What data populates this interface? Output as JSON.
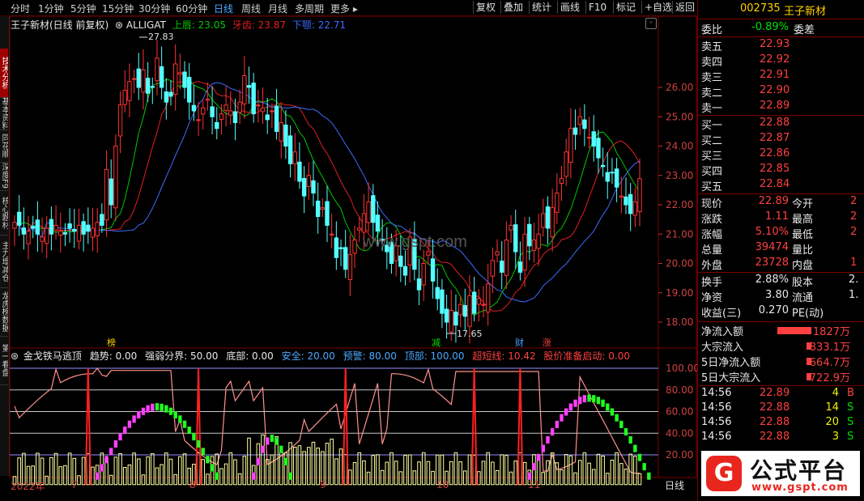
{
  "toolbar": {
    "periods": [
      "分时",
      "1分钟",
      "5分钟",
      "15分钟",
      "30分钟",
      "60分钟",
      "日线",
      "周线",
      "月线",
      "多周期",
      "更多 ▸"
    ],
    "active_period": "日线",
    "buttons": [
      "复权",
      "叠加",
      "统计",
      "画线",
      "F10",
      "标记",
      "+自选",
      "返回"
    ],
    "close_glyph": "⊗"
  },
  "side_tabs": [
    "技术分析",
    "基本资料",
    "同花顺F10",
    "深度F9",
    "核心题材",
    "主力增减仓",
    "龙虎榜数据",
    "第一看盘"
  ],
  "main_chart": {
    "title": "王子新材(日线 前复权)",
    "indicator_name": "ALLIGAT",
    "upper_label": "上唇: 23.05",
    "teeth_label": "牙齿: 23.87",
    "lower_label": "下颚: 22.71",
    "high_label": "27.83",
    "low_label": "17.65",
    "watermark": "www.gspt.com",
    "y_ticks": [
      "26.00",
      "25.00",
      "24.00",
      "23.00",
      "22.00",
      "21.00",
      "20.00",
      "19.00",
      "18.00"
    ],
    "markers": [
      "榜",
      "减",
      "财",
      "涨"
    ]
  },
  "indicator": {
    "title": "金戈铁马逃顶",
    "items": [
      "趋势: 0.00",
      "强弱分界: 50.00",
      "底部: 0.00",
      "安全: 20.00",
      "预警: 80.00",
      "顶部: 100.00",
      "超短线: 10.42",
      "股价准备启动: 0.00"
    ],
    "y_ticks": [
      "100.00",
      "80.00",
      "60.00",
      "40.00",
      "20.00"
    ]
  },
  "x_axis": [
    "2022年",
    "7",
    "8",
    "9",
    "10",
    "11"
  ],
  "x_cursor": "日线",
  "quote": {
    "code": "002735",
    "name": "王子新材",
    "weibi_label": "委比",
    "weibi_value": "-0.89%",
    "weicha_label": "委差",
    "asks": [
      {
        "label": "卖五",
        "price": "22.93"
      },
      {
        "label": "卖四",
        "price": "22.92"
      },
      {
        "label": "卖三",
        "price": "22.91"
      },
      {
        "label": "卖二",
        "price": "22.90"
      },
      {
        "label": "卖一",
        "price": "22.89"
      }
    ],
    "bids": [
      {
        "label": "买一",
        "price": "22.88"
      },
      {
        "label": "买二",
        "price": "22.87"
      },
      {
        "label": "买三",
        "price": "22.86"
      },
      {
        "label": "买四",
        "price": "22.85"
      },
      {
        "label": "买五",
        "price": "22.84"
      }
    ],
    "stats": [
      {
        "l1": "现价",
        "v1": "22.89",
        "l2": "今开",
        "v2": "2"
      },
      {
        "l1": "涨跌",
        "v1": "1.11",
        "l2": "最高",
        "v2": "2"
      },
      {
        "l1": "涨幅",
        "v1": "5.10%",
        "l2": "最低",
        "v2": "2"
      },
      {
        "l1": "总量",
        "v1": "39474",
        "l2": "量比",
        "v2": ""
      },
      {
        "l1": "外盘",
        "v1": "23728",
        "l2": "内盘",
        "v2": "1"
      }
    ],
    "stats2": [
      {
        "l1": "换手",
        "v1": "2.88%",
        "l2": "股本",
        "v2": "2."
      },
      {
        "l1": "净资",
        "v1": "3.80",
        "l2": "流通",
        "v2": "1."
      },
      {
        "l1": "收益(三)",
        "v1": "0.270",
        "l2": "PE(动)",
        "v2": ""
      }
    ],
    "flows": [
      {
        "label": "净流入额",
        "value": "1827万",
        "bar": 1.0
      },
      {
        "label": "大宗流入",
        "value": "833.1万",
        "bar": 0.15
      },
      {
        "label": "5日净流入额",
        "value": "664.7万",
        "bar": 0.12
      },
      {
        "label": "5日大宗流入",
        "value": "722.9万",
        "bar": 0.12
      }
    ],
    "ticks": [
      {
        "time": "14:56",
        "price": "22.89",
        "vol": "4",
        "dir": "B"
      },
      {
        "time": "14:56",
        "price": "22.88",
        "vol": "14",
        "dir": "S"
      },
      {
        "time": "14:56",
        "price": "22.88",
        "vol": "20",
        "dir": "S"
      },
      {
        "time": "14:56",
        "price": "22.88",
        "vol": "3",
        "dir": "S"
      }
    ]
  },
  "logo": {
    "name": "公式平台",
    "url": "www.gspt.com",
    "mark": "G"
  },
  "colors": {
    "up": "#ff3232",
    "down": "#54ffff",
    "upper_lip": "#00c800",
    "teeth": "#e02020",
    "lower_jaw": "#3c6cff",
    "pink": "#ff40ff",
    "green_bar": "#20ff20",
    "cream": "#ffffa0"
  }
}
